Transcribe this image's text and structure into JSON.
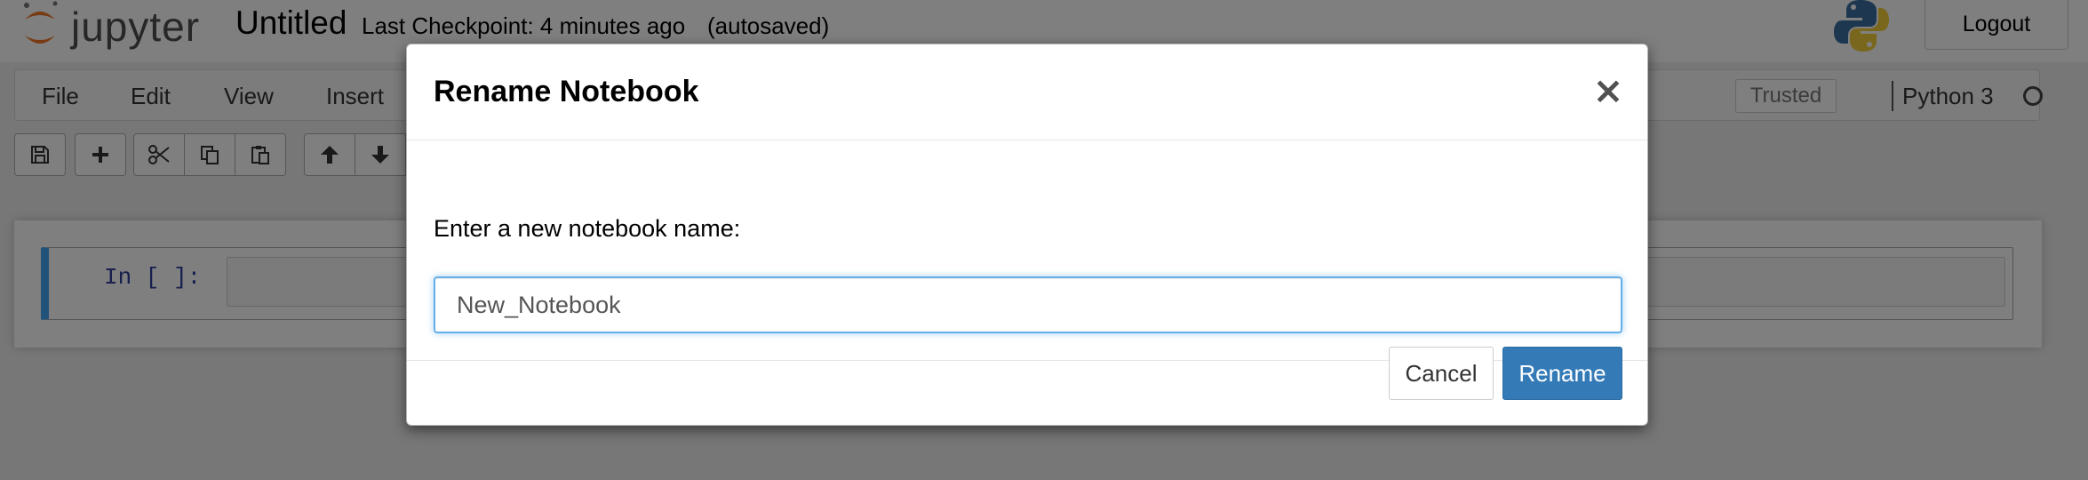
{
  "header": {
    "logo_text": "jupyter",
    "notebook_name": "Untitled",
    "checkpoint_text": "Last Checkpoint: 4 minutes ago",
    "autosave_status": "(autosaved)",
    "logout_label": "Logout"
  },
  "menubar": {
    "items": [
      "File",
      "Edit",
      "View",
      "Insert"
    ],
    "trusted_label": "Trusted",
    "kernel_name": "Python 3"
  },
  "toolbar": {
    "buttons": [
      "save-icon",
      "plus-icon",
      "cut-icon",
      "copy-icon",
      "paste-icon",
      "arrow-up-icon",
      "arrow-down-icon"
    ]
  },
  "cell": {
    "prompt": "In [ ]:"
  },
  "dialog": {
    "title": "Rename Notebook",
    "close_symbol": "×",
    "label": "Enter a new notebook name:",
    "input_value": "New_Notebook",
    "cancel_label": "Cancel",
    "rename_label": "Rename"
  },
  "colors": {
    "accent": "#337ab7",
    "cell_selected": "#42a5f5",
    "jupyter_orange": "#f37726"
  }
}
